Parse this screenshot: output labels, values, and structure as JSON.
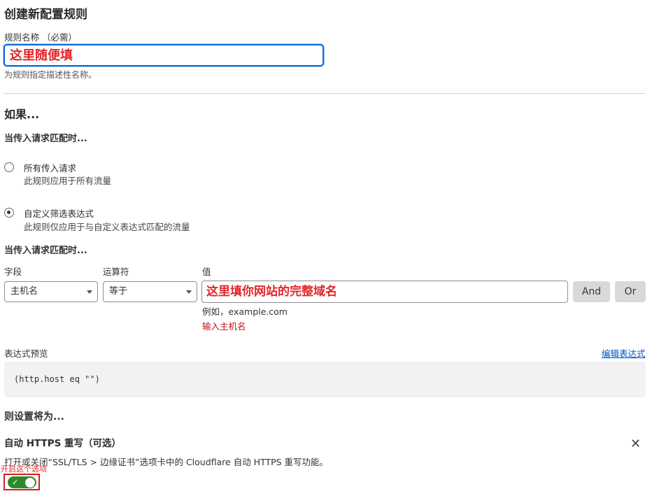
{
  "header": {
    "title": "创建新配置规则"
  },
  "rule_name": {
    "label": "规则名称 （必需）",
    "value": "这里随便填",
    "help": "为规则指定描述性名称。"
  },
  "if_section": {
    "heading": "如果...",
    "match_label": "当传入请求匹配时...",
    "options": [
      {
        "title": "所有传入请求",
        "desc": "此规则应用于所有流量",
        "selected": false
      },
      {
        "title": "自定义筛选表达式",
        "desc": "此规则仅应用于与自定义表达式匹配的流量",
        "selected": true
      }
    ]
  },
  "expression_builder": {
    "match_label": "当传入请求匹配时...",
    "field_label": "字段",
    "operator_label": "运算符",
    "value_label": "值",
    "field_value": "主机名",
    "operator_value": "等于",
    "value_input": "这里填你网站的完整域名",
    "value_example": "例如，example.com",
    "value_error": "输入主机名",
    "and_button": "And",
    "or_button": "Or"
  },
  "preview": {
    "label": "表达式预览",
    "edit_link": "编辑表达式",
    "code": "(http.host eq \"\")"
  },
  "then_section": {
    "heading": "则设置将为...",
    "setting_title": "自动 HTTPS 重写（可选）",
    "setting_desc": "打开或关闭“SSL/TLS > 边缘证书”选项卡中的 Cloudflare 自动 HTTPS 重写功能。",
    "annotation": "开启这个选项",
    "toggle_on": true,
    "toggle_check": "✓",
    "close_symbol": "✕"
  },
  "colors": {
    "accent_blue": "#0f6cd6",
    "annotation_red": "#e3262a",
    "toggle_green": "#2b8a2b",
    "link_blue": "#0051c3"
  }
}
